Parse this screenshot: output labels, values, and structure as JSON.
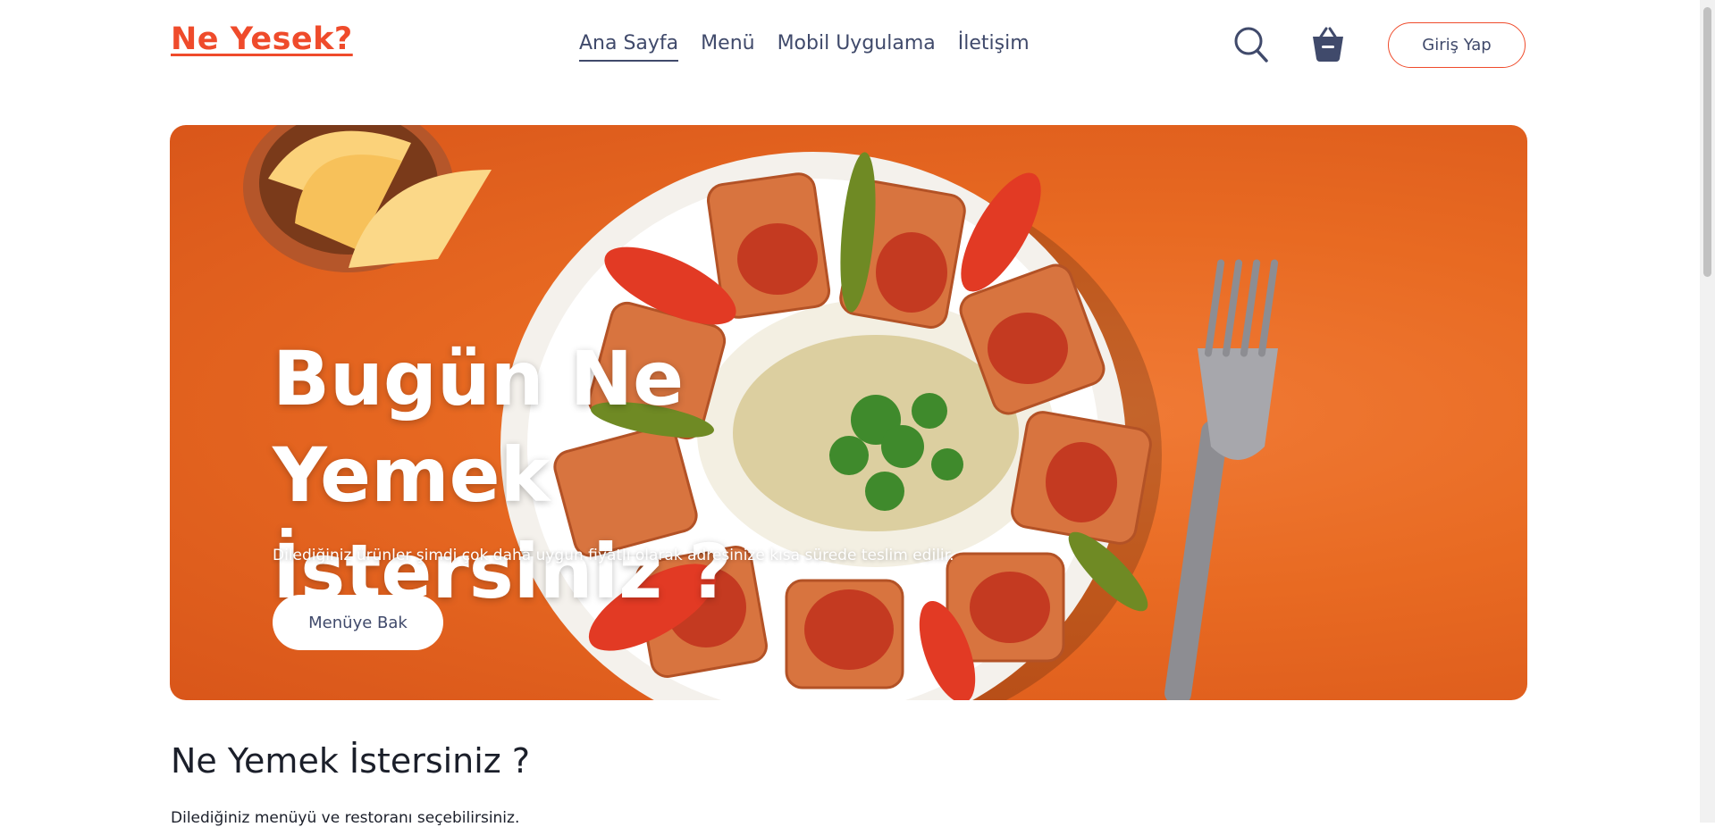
{
  "header": {
    "logo": "Ne Yesek?",
    "nav": [
      "Ana Sayfa",
      "Menü",
      "Mobil Uygulama",
      "İletişim"
    ],
    "active_nav": "Ana Sayfa",
    "search_icon": "search-icon",
    "cart_icon": "basket-icon",
    "login_label": "Giriş Yap"
  },
  "hero": {
    "title_line1": "Bugün Ne Yemek",
    "title_line2": "İstersiniz ?",
    "subtitle": "Dilediğiniz ürünler şimdi çok daha uygun fiyatlı olarak adresinize kısa sürede teslim edilir.",
    "button_label": "Menüye Bak"
  },
  "section": {
    "title": "Ne Yemek İstersiniz ?",
    "subtitle": "Dilediğiniz menüyü ve restoranı seçebilirsiniz."
  },
  "colors": {
    "brand": "#ef4b2b",
    "hero_bg": "#e86a22",
    "nav_text": "#404a6b"
  }
}
